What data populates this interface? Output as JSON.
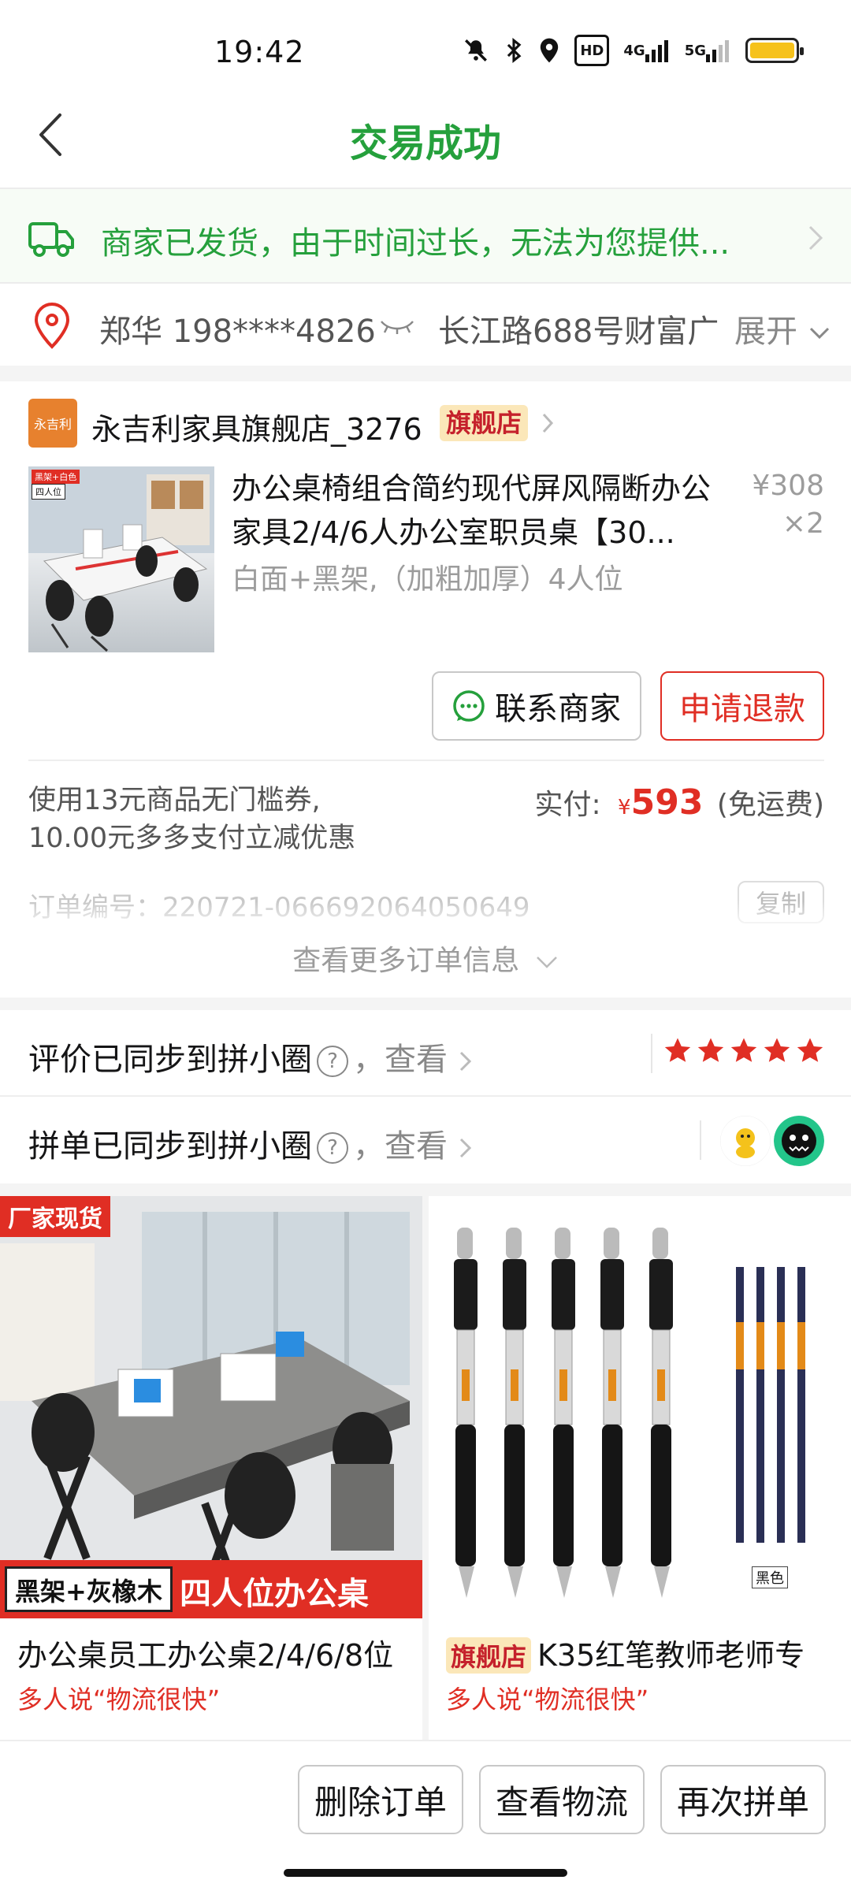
{
  "status_bar": {
    "time": "19:42",
    "icons": [
      "mute-bell-icon",
      "bluetooth-icon",
      "location-icon",
      "hd-icon",
      "4g-signal-icon",
      "5g-signal-icon",
      "battery-icon"
    ],
    "hd_label": "HD",
    "net1": "4G",
    "net2": "5G"
  },
  "header": {
    "title": "交易成功",
    "title_color": "#25a03c"
  },
  "logistics": {
    "text": "商家已发货，由于时间过长，无法为您提供..."
  },
  "address": {
    "name_phone": "郑华  198****4826",
    "street": "长江路688号财富广",
    "expand_label": "展开"
  },
  "order": {
    "store_logo_text": "永吉利",
    "store_name": "永吉利家具旗舰店_3276",
    "store_flag": "旗舰店",
    "product_title": "办公桌椅组合简约现代屏风隔断办公家具2/4/6人办公室职员桌【30...",
    "product_spec": "白面+黑架,（加粗加厚）4人位",
    "unit_price": "¥308",
    "quantity": "×2",
    "contact_label": "联系商家",
    "refund_label": "申请退款",
    "promo_text": "使用13元商品无门槛券,\n10.00元多多支付立减优惠",
    "paid_label": "实付:",
    "currency": "¥",
    "paid_amount": "593",
    "shipping_note": "(免运费)",
    "order_no": "订单编号：220721-066692064050649",
    "copy_label": "复制",
    "more_label": "查看更多订单信息",
    "img_badge_1": "黑架+白色",
    "img_badge_2": "四人位"
  },
  "sync": {
    "review_label": "评价已同步到拼小圈",
    "group_label": "拼单已同步到拼小圈",
    "q_mark": "?",
    "look_label": "，查看",
    "rating": 5
  },
  "recommendations": [
    {
      "corner_tag": "厂家现货",
      "banner_a": "黑架+灰橡木",
      "banner_b": "四人位办公桌",
      "title": "办公桌员工办公桌2/4/6/8位",
      "subtitle": "多人说“物流很快”"
    },
    {
      "flag": "旗舰店",
      "title": "K35红笔教师老师专",
      "subtitle": "多人说“物流很快”",
      "refill_label": "黑色"
    }
  ],
  "bottom": {
    "delete_label": "删除订单",
    "logistics_label": "查看物流",
    "rebuy_label": "再次拼单"
  },
  "colors": {
    "accent_green": "#25a03c",
    "price_red": "#e02e24",
    "flag_bg": "#fbe7b9"
  }
}
